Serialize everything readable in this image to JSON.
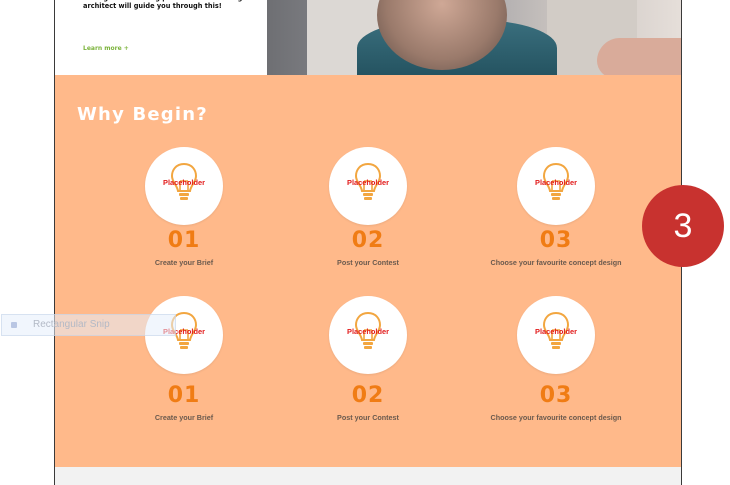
{
  "hero": {
    "body_text": "through the building process. Your leading architect will guide you through this!",
    "learn_more": "Learn more +"
  },
  "why": {
    "title": "Why Begin?",
    "steps_row1": [
      {
        "placeholder": "Placeholder",
        "number": "01",
        "caption": "Create your Brief"
      },
      {
        "placeholder": "Placeholder",
        "number": "02",
        "caption": "Post your Contest"
      },
      {
        "placeholder": "Placeholder",
        "number": "03",
        "caption": "Choose your favourite concept design"
      }
    ],
    "steps_row2": [
      {
        "placeholder": "Placeholder",
        "number": "01",
        "caption": "Create your Brief"
      },
      {
        "placeholder": "Placeholder",
        "number": "02",
        "caption": "Post your Contest"
      },
      {
        "placeholder": "Placeholder",
        "number": "03",
        "caption": "Choose your favourite concept design"
      }
    ],
    "icon": "lightbulb-icon"
  },
  "overlay": {
    "badge_number": "3",
    "snip_label": "Rectangular Snip"
  },
  "colors": {
    "section_bg": "#ffb98a",
    "number_color": "#f07c14",
    "placeholder_color": "#e21b1b",
    "badge_bg": "#c8322f",
    "learn_more_color": "#7bb33b"
  }
}
